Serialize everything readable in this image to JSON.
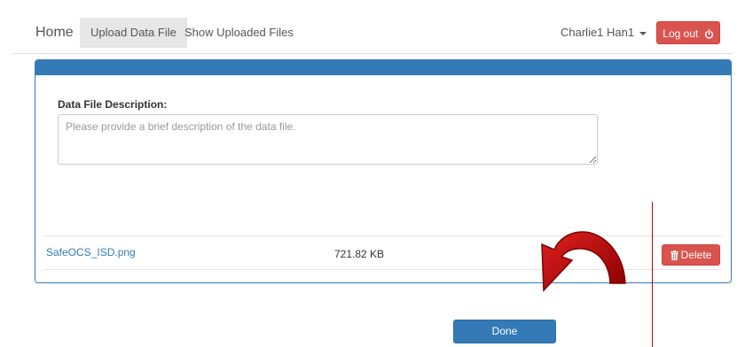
{
  "navbar": {
    "home_label": "Home",
    "tabs": [
      {
        "label": "Upload Data File",
        "active": true
      },
      {
        "label": "Show Uploaded Files",
        "active": false
      }
    ],
    "user_label": "Charlie1 Han1",
    "logout_label": "Log out"
  },
  "form": {
    "description_label": "Data File Description:",
    "description_placeholder": "Please provide a brief description of the data file.",
    "description_value": ""
  },
  "file": {
    "name": "SafeOCS_ISD.png",
    "size": "721.82 KB",
    "delete_label": "Delete"
  },
  "done_label": "Done",
  "colors": {
    "primary": "#337ab7",
    "danger": "#d9534f",
    "annotation_arrow": "#cc0000"
  }
}
